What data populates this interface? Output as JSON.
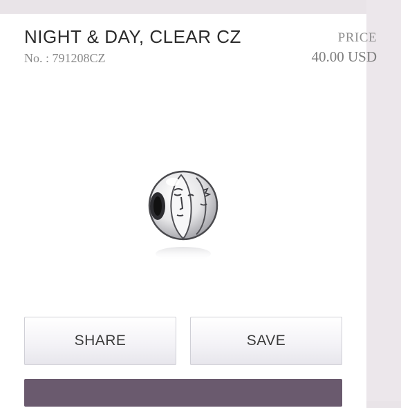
{
  "product": {
    "title": "NIGHT & DAY, CLEAR CZ",
    "sku": "No. : 791208CZ",
    "price_label": "PRICE",
    "price_value": "40.00 USD",
    "image_icon": "night-and-day-charm"
  },
  "actions": {
    "share_label": "SHARE",
    "save_label": "SAVE"
  },
  "colors": {
    "background": "#e9e4e8",
    "card": "#ffffff",
    "bottom_bar": "#6a5a6e"
  }
}
